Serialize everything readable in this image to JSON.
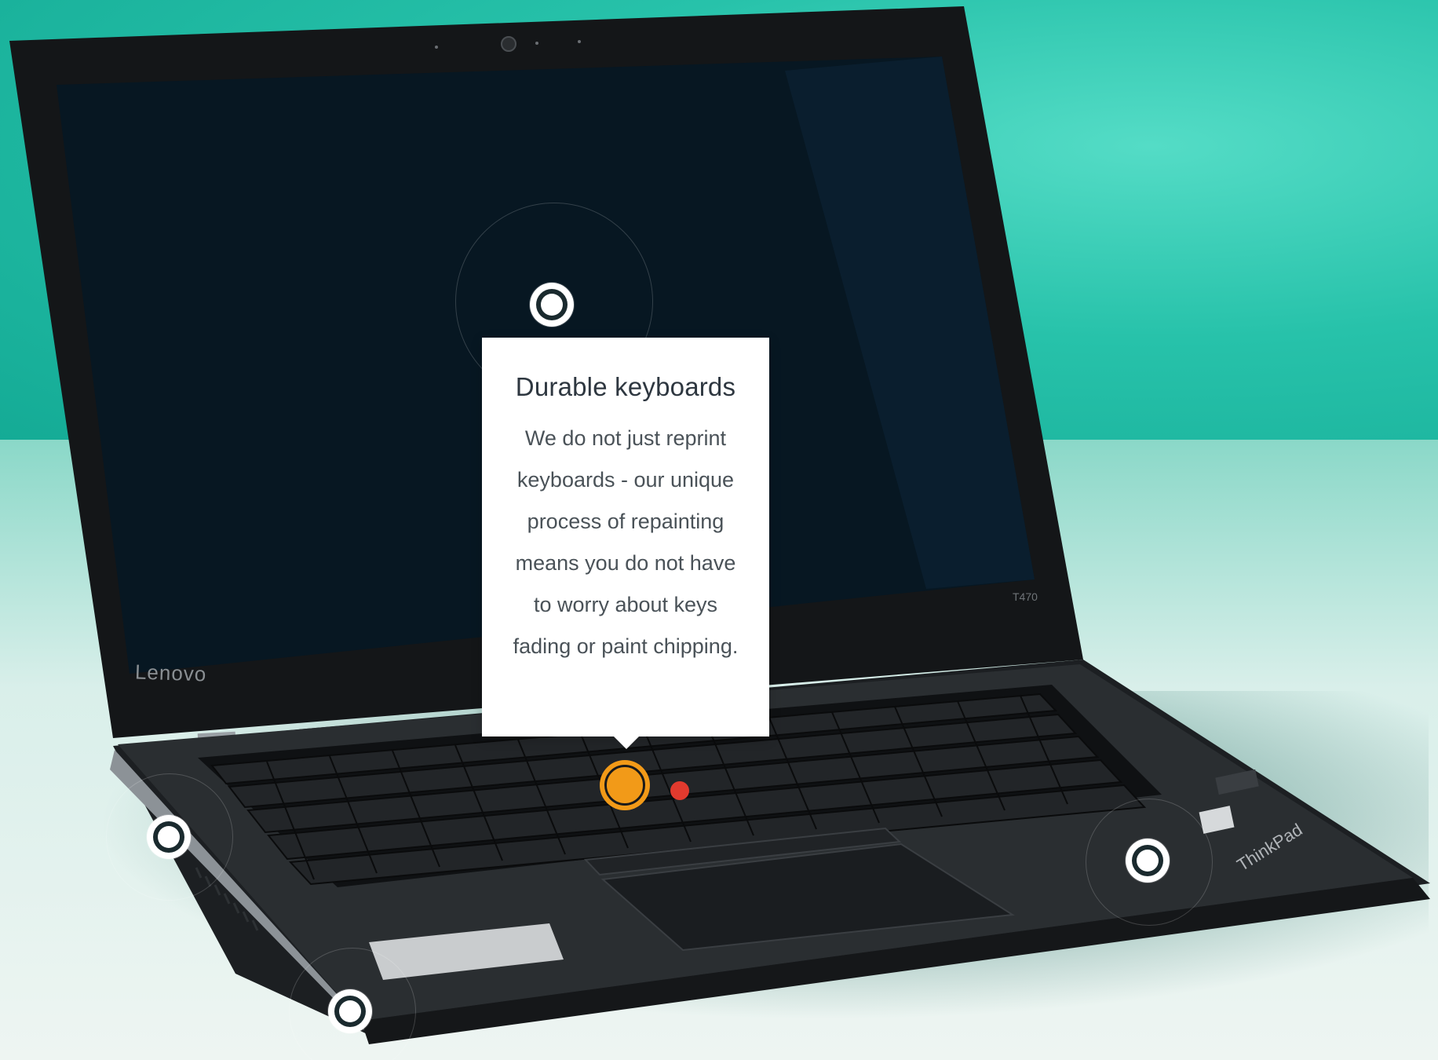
{
  "tooltip": {
    "title": "Durable keyboards",
    "body": "We do not just reprint keyboards - our unique process of repainting means you do not have to worry about keys fading or paint chipping."
  },
  "laptop": {
    "brand": "Lenovo",
    "model": "T470"
  },
  "hotspots": [
    {
      "name": "screen",
      "active": false
    },
    {
      "name": "keyboard",
      "active": true
    },
    {
      "name": "ports",
      "active": false
    },
    {
      "name": "palmrest",
      "active": false
    },
    {
      "name": "front-edge",
      "active": false
    }
  ],
  "colors": {
    "background": "#27c2aa",
    "hotspot_active": "#f29a18",
    "hotspot": "#ffffff",
    "tooltip_bg": "#ffffff"
  }
}
